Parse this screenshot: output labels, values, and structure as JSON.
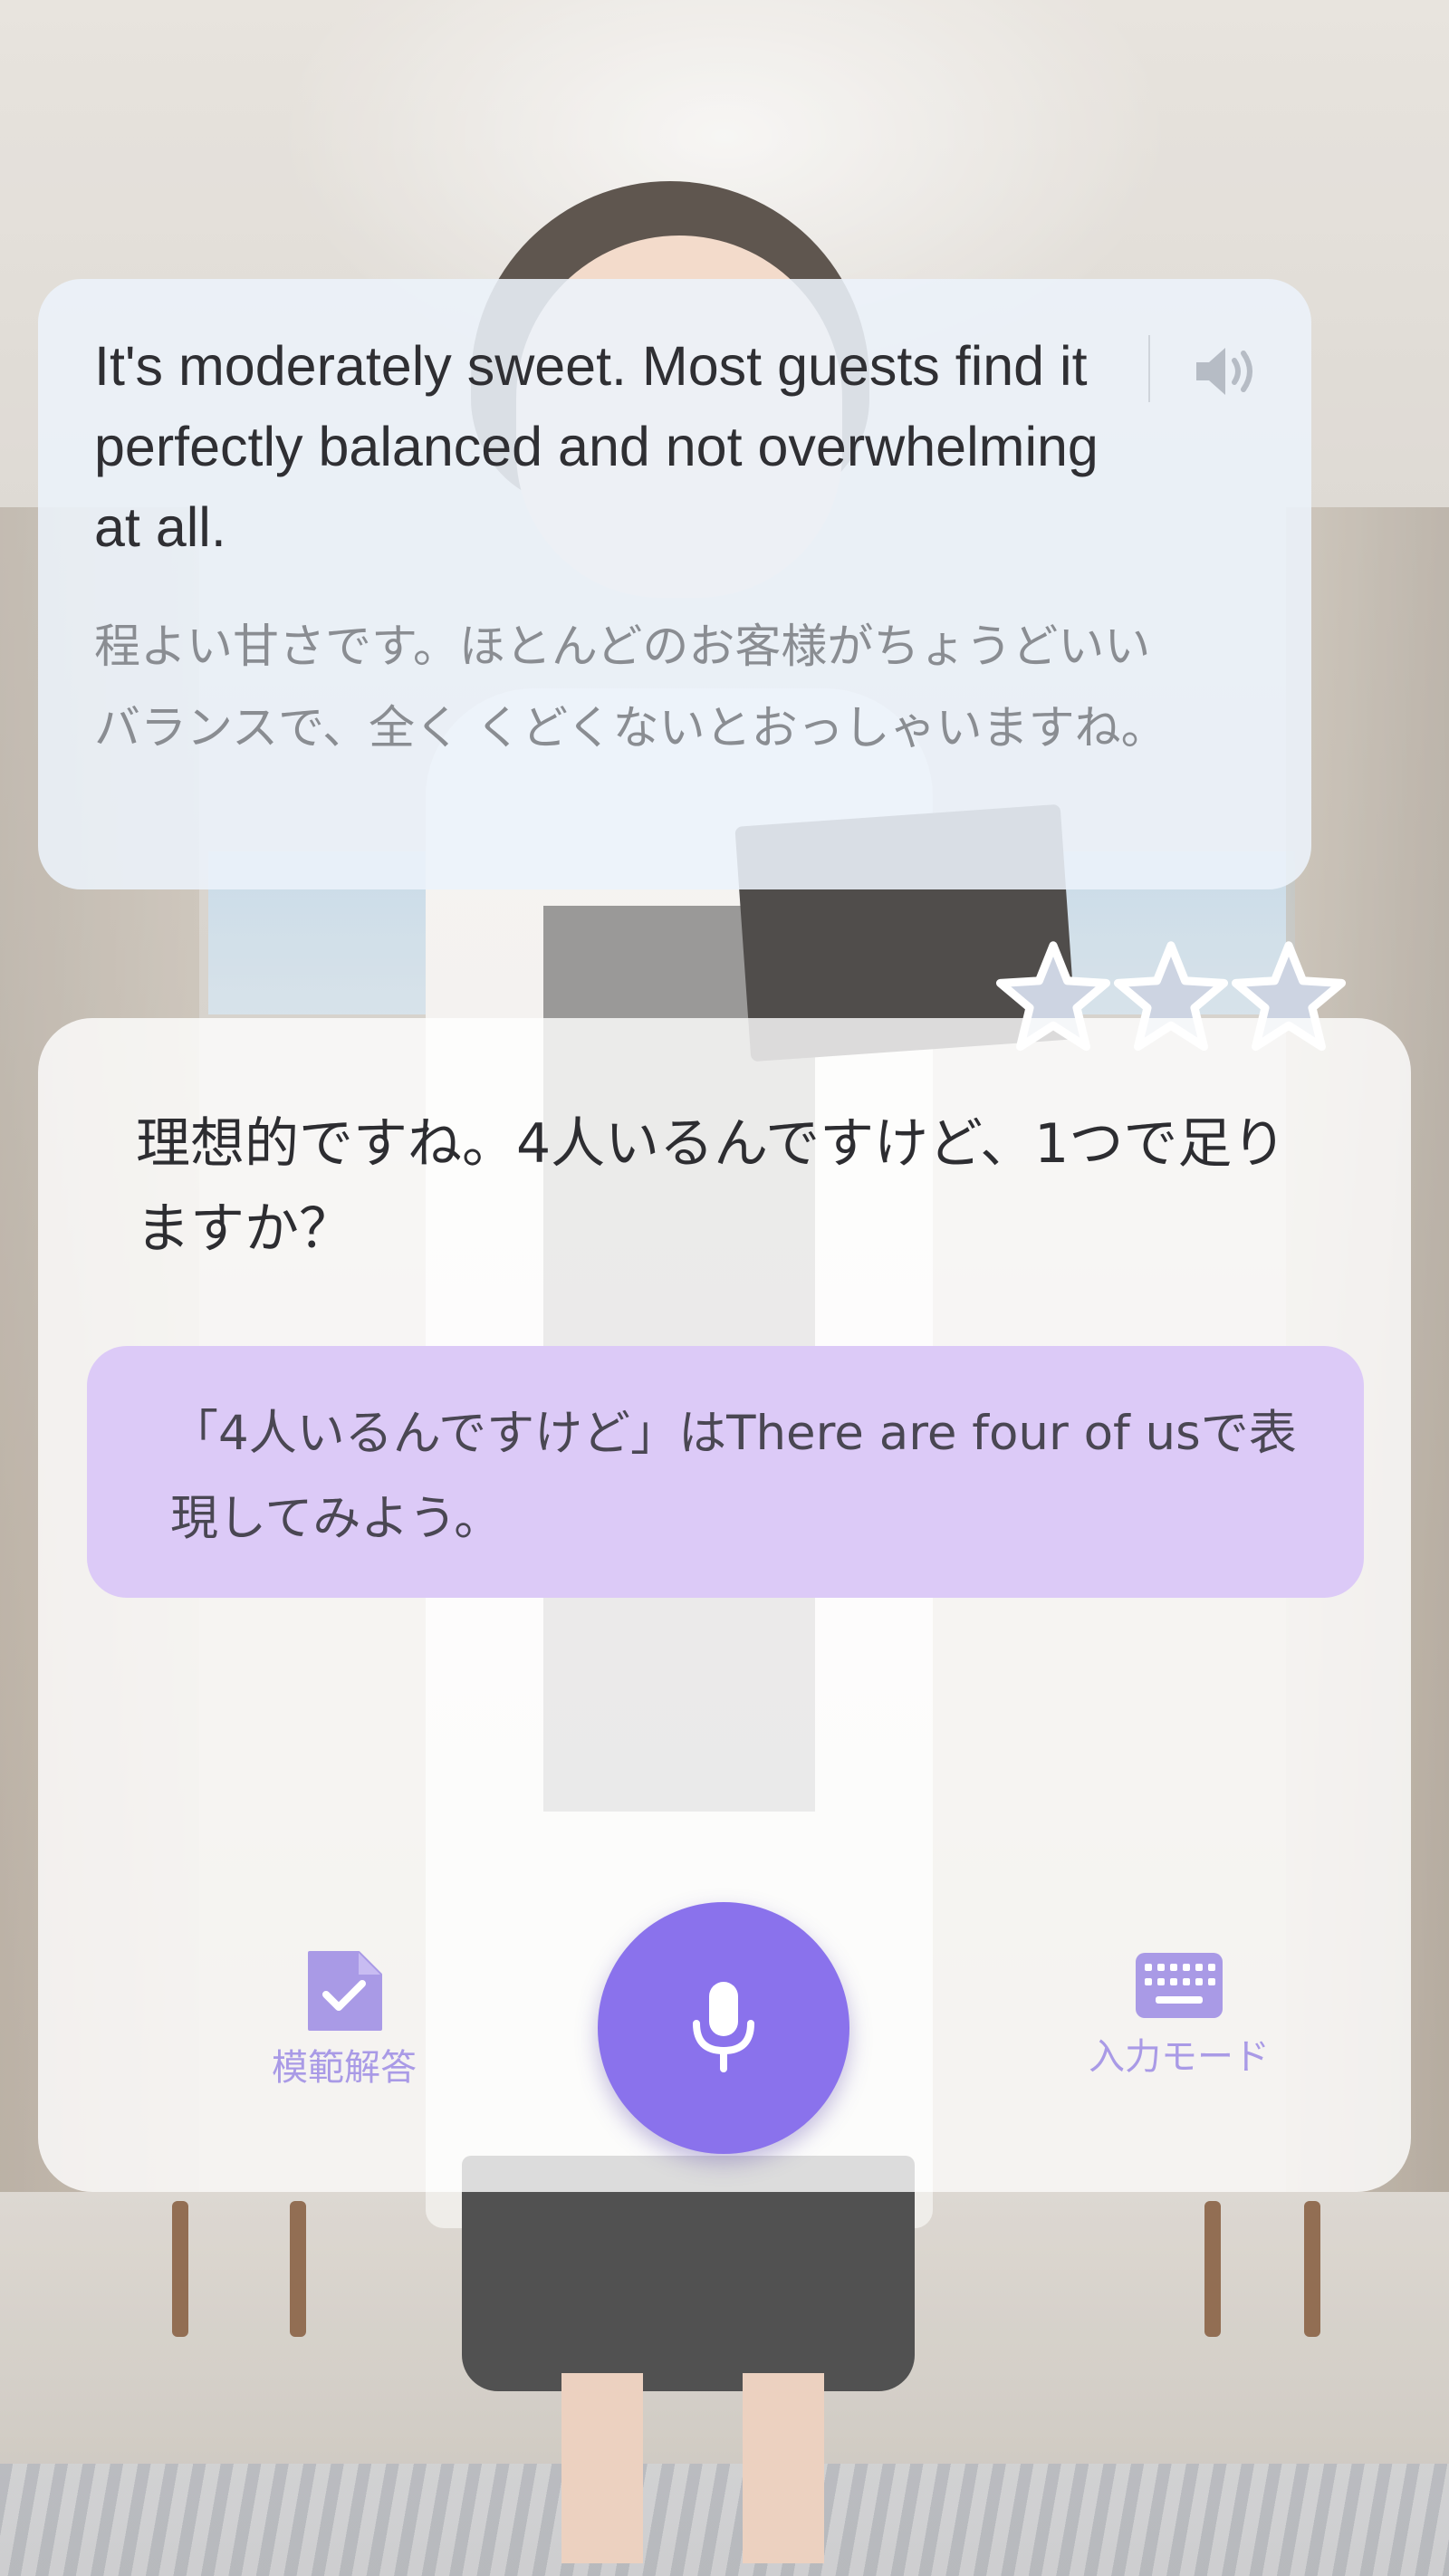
{
  "bubble": {
    "english": "It's moderately sweet. Most guests find it perfectly balanced and not overwhelming at all.",
    "japanese": "程よい甘さです。ほとんどのお客様がちょうどいいバランスで、全く くどくないとおっしゃいますね。",
    "speaker_icon": "speaker-icon"
  },
  "rating": {
    "stars_total": 3,
    "stars_filled": 0,
    "star_color": "#cdd4e2"
  },
  "card": {
    "prompt": "理想的ですね。4人いるんですけど、1つで足りますか？",
    "hint": "「4人いるんですけど」はThere are four of usで表現してみよう。"
  },
  "actions": {
    "model_answer_label": "模範解答",
    "model_answer_icon": "checked-document-icon",
    "input_mode_label": "入力モード",
    "input_mode_icon": "keyboard-icon",
    "mic_icon": "microphone-icon"
  },
  "colors": {
    "accent": "#8a72ec",
    "hint_bg": "#dccaf7",
    "label": "#a99ae6"
  }
}
